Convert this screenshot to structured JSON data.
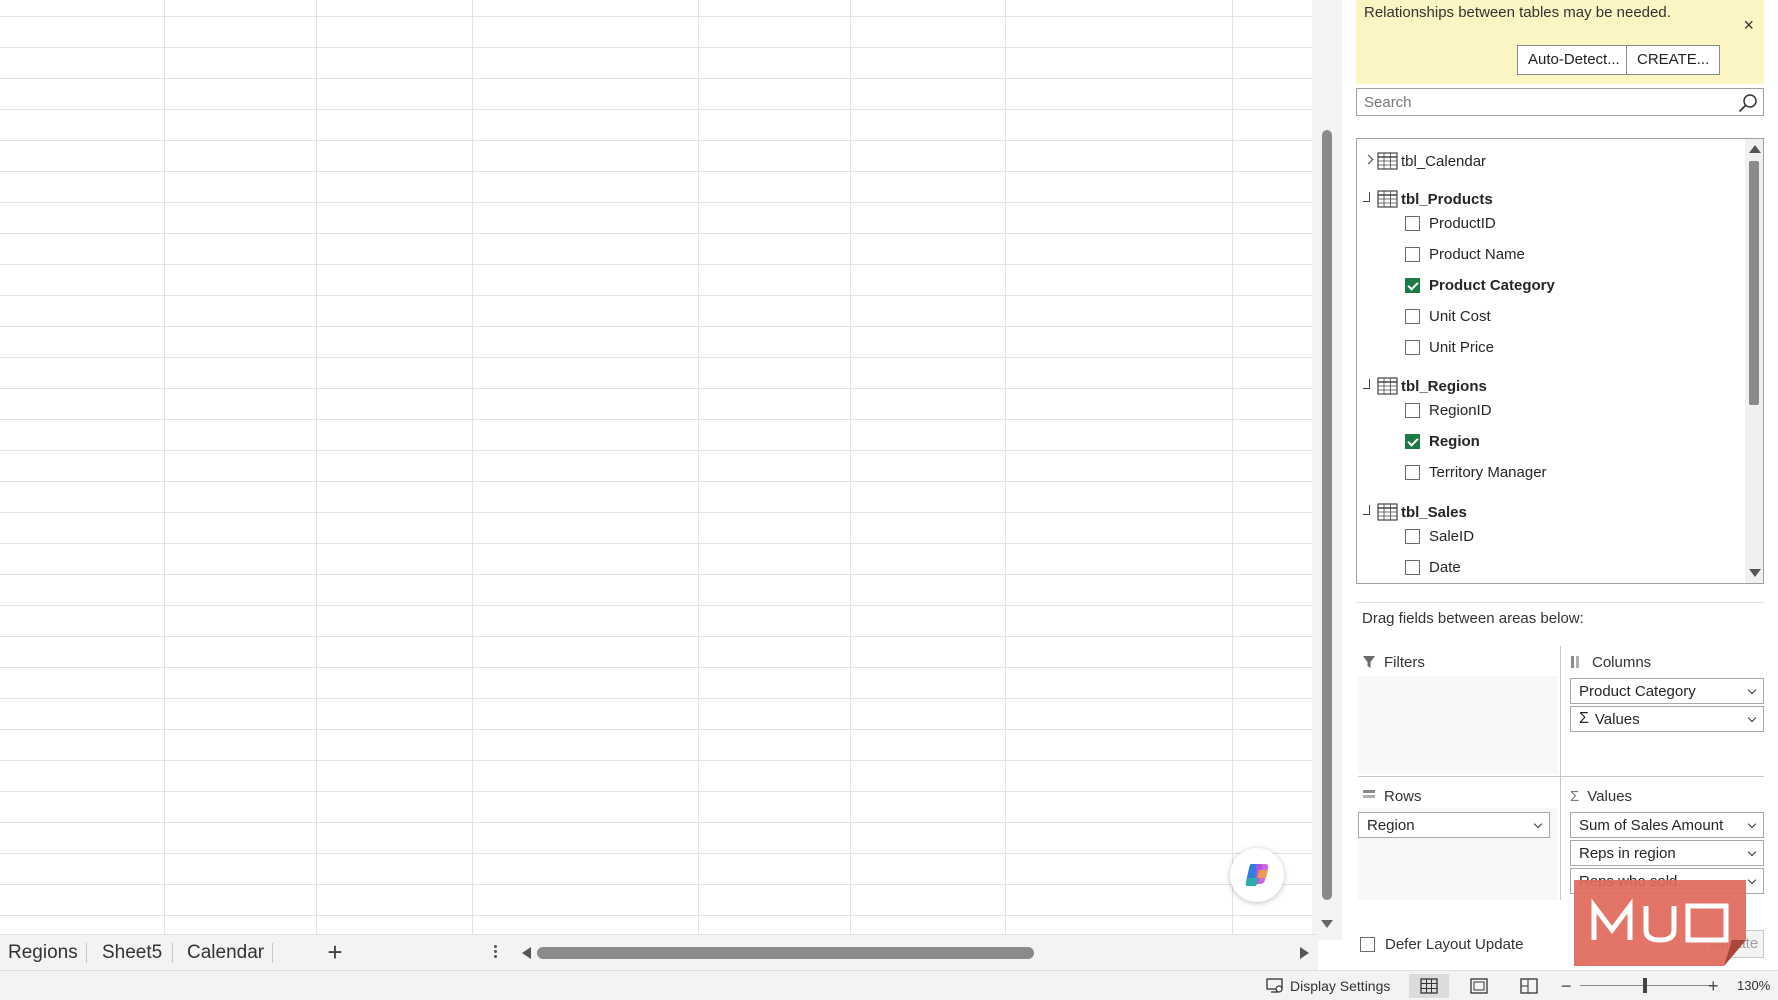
{
  "sheet_tabs": [
    "Regions",
    "Sheet5",
    "Calendar"
  ],
  "add_sheet_label": "+",
  "notice": {
    "text": "Relationships between tables may be needed.",
    "close_label": "×",
    "auto_detect_label": "Auto-Detect...",
    "create_label": "CREATE..."
  },
  "search": {
    "placeholder": "Search"
  },
  "field_list": {
    "tables": [
      {
        "name": "tbl_Calendar",
        "expanded": false,
        "fields": []
      },
      {
        "name": "tbl_Products",
        "expanded": true,
        "fields": [
          {
            "name": "ProductID",
            "checked": false
          },
          {
            "name": "Product Name",
            "checked": false
          },
          {
            "name": "Product Category",
            "checked": true
          },
          {
            "name": "Unit Cost",
            "checked": false
          },
          {
            "name": "Unit Price",
            "checked": false
          }
        ]
      },
      {
        "name": "tbl_Regions",
        "expanded": true,
        "fields": [
          {
            "name": "RegionID",
            "checked": false
          },
          {
            "name": "Region",
            "checked": true
          },
          {
            "name": "Territory Manager",
            "checked": false
          }
        ]
      },
      {
        "name": "tbl_Sales",
        "expanded": true,
        "fields": [
          {
            "name": "SaleID",
            "checked": false
          },
          {
            "name": "Date",
            "checked": false
          }
        ]
      }
    ]
  },
  "areas": {
    "hint": "Drag fields between areas below:",
    "filters": {
      "label": "Filters",
      "items": []
    },
    "columns": {
      "label": "Columns",
      "items": [
        "Product Category",
        "Values"
      ]
    },
    "rows": {
      "label": "Rows",
      "items": [
        "Region"
      ]
    },
    "values": {
      "label": "Values",
      "items": [
        "Sum of Sales Amount",
        "Reps in region",
        "Reps who sold"
      ]
    }
  },
  "defer_label": "Defer Layout Update",
  "update_label": "Update",
  "status": {
    "display_settings": "Display Settings",
    "zoom_minus": "−",
    "zoom_plus": "+",
    "zoom_level": "130%"
  },
  "colors": {
    "notice_bg": "#fbf5c3",
    "checkbox_checked": "#1e7a45",
    "watermark": "#e06a5c"
  }
}
